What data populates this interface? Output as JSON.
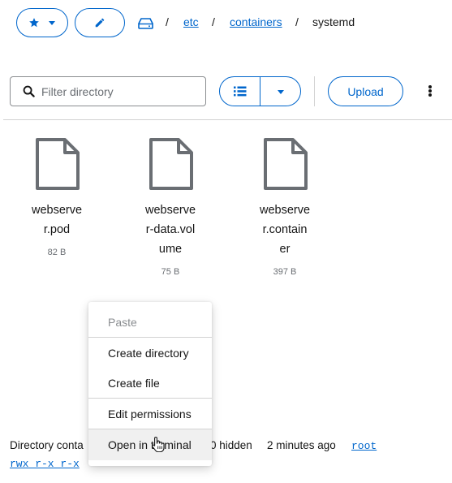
{
  "toolbar": {
    "favorites_icon": "star-icon",
    "favorites_caret_icon": "caret-down-icon",
    "edit_icon": "pencil-icon",
    "drive_icon": "hard-drive-icon"
  },
  "breadcrumb": {
    "separator": "/",
    "items": [
      "etc",
      "containers"
    ],
    "current": "systemd"
  },
  "search": {
    "placeholder": "Filter directory",
    "value": ""
  },
  "view_toggle": {
    "list_icon": "list-icon",
    "caret_icon": "caret-down-icon"
  },
  "upload_label": "Upload",
  "files": [
    {
      "name": "webserver.pod",
      "lines": [
        "webserve",
        "r.pod"
      ],
      "size": "82 B"
    },
    {
      "name": "webserver-data.volume",
      "lines": [
        "webserve",
        "r-data.vol",
        "ume"
      ],
      "size": "75 B"
    },
    {
      "name": "webserver.container",
      "lines": [
        "webserve",
        "r.contain",
        "er"
      ],
      "size": "397 B"
    }
  ],
  "context_menu": {
    "paste": "Paste",
    "create_directory": "Create directory",
    "create_file": "Create file",
    "edit_permissions": "Edit permissions",
    "open_in_terminal": "Open in terminal"
  },
  "footer": {
    "summary_left": "Directory conta",
    "summary_right": "0 hidden",
    "modified": "2 minutes ago",
    "owner": "root",
    "permissions": "rwx r-x r-x"
  },
  "colors": {
    "accent": "#0066cc",
    "text": "#151515",
    "muted": "#6a6e73",
    "border": "#d2d2d2",
    "icon": "#6a6e73"
  }
}
